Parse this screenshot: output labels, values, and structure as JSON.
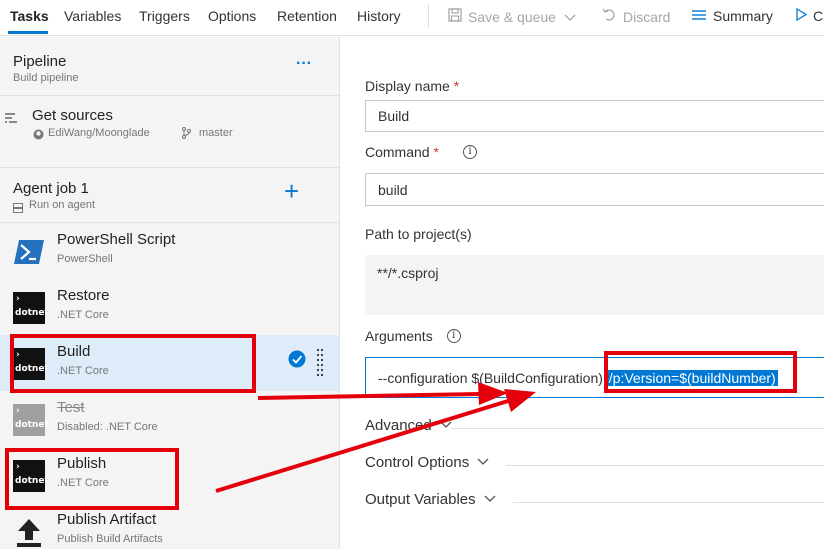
{
  "topbar": {
    "tabs": [
      "Tasks",
      "Variables",
      "Triggers",
      "Options",
      "Retention",
      "History"
    ],
    "save_label": "Save & queue",
    "discard_label": "Discard",
    "summary_label": "Summary",
    "queue_partial": "C"
  },
  "pipeline": {
    "title": "Pipeline",
    "subtitle": "Build pipeline",
    "more": "···"
  },
  "sources": {
    "title": "Get sources",
    "repo": "EdiWang/Moonglade",
    "branch": "master"
  },
  "agent_job": {
    "title": "Agent job 1",
    "subtitle": "Run on agent",
    "add": "+"
  },
  "tasks": [
    {
      "title": "PowerShell Script",
      "subtitle": "PowerShell",
      "icon": "powershell-icon"
    },
    {
      "title": "Restore",
      "subtitle": ".NET Core",
      "icon": "dotnet-icon"
    },
    {
      "title": "Build",
      "subtitle": ".NET Core",
      "icon": "dotnet-icon"
    },
    {
      "title": "Test",
      "subtitle": "Disabled: .NET Core",
      "icon": "dotnet-icon"
    },
    {
      "title": "Publish",
      "subtitle": ".NET Core",
      "icon": "dotnet-icon"
    },
    {
      "title": "Publish Artifact",
      "subtitle": "Publish Build Artifacts",
      "icon": "upload-icon"
    }
  ],
  "dotnet_text": "dotnet",
  "form": {
    "display_name_label": "Display name",
    "display_name_value": "Build",
    "command_label": "Command",
    "command_value": "build",
    "path_label": "Path to project(s)",
    "path_value": "**/*.csproj",
    "arguments_label": "Arguments",
    "arguments_plain": "--configuration $(BuildConfiguration) ",
    "arguments_selected": "/p:Version=$(buildNumber)",
    "required_mark": "*",
    "info": "i"
  },
  "sections": [
    "Advanced",
    "Control Options",
    "Output Variables"
  ],
  "colors": {
    "accent": "#0078d4",
    "annotation": "#e3000b",
    "selected_row": "#deecf9"
  }
}
